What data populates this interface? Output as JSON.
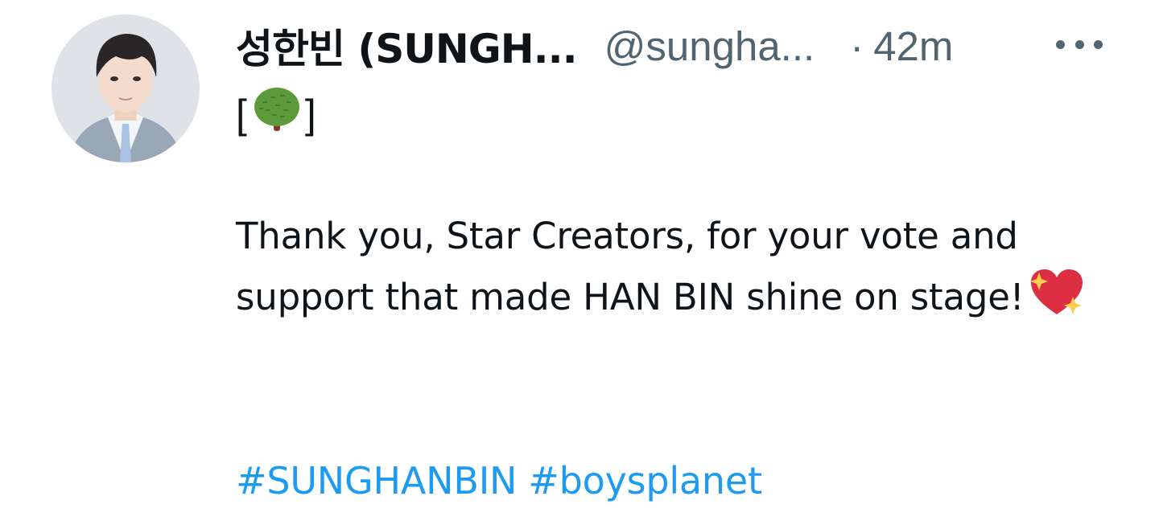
{
  "tweet": {
    "author": {
      "display_name": "성한빈 (SUNGH...",
      "handle": "@sungha...",
      "avatar_icon": "profile-photo"
    },
    "separator": "·",
    "timestamp": "42m",
    "more_icon": "more-horizontal-icon",
    "first_line": {
      "open_bracket": "[",
      "emoji": "deciduous-tree-emoji",
      "close_bracket": "]"
    },
    "body": "Thank you, Star Creators, for your vote and support that made HAN BIN shine on stage!",
    "body_emoji": "sparkling-heart-emoji",
    "hashtags": [
      "#SUNGHANBIN",
      "#boysplanet"
    ]
  },
  "colors": {
    "text": "#0f1419",
    "secondary": "#536471",
    "link": "#1d9bf0",
    "background": "#ffffff"
  }
}
